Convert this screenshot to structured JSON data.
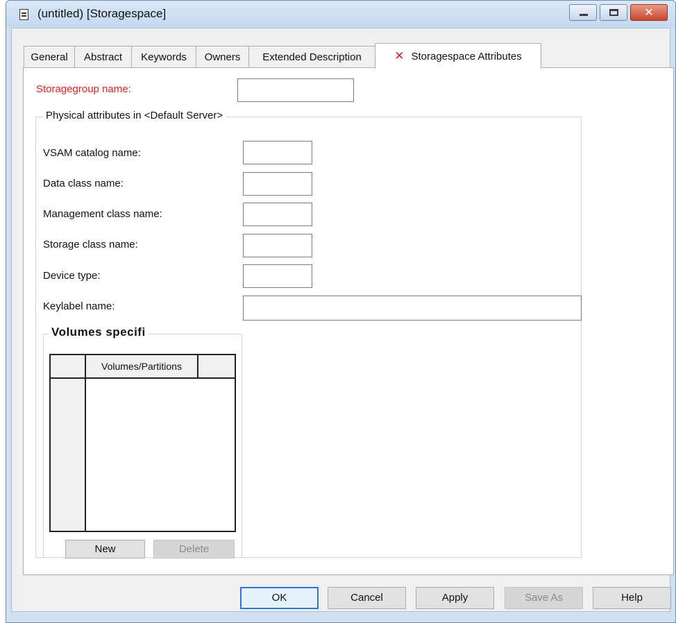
{
  "window": {
    "title": "(untitled) [Storagespace]",
    "icons": {
      "title": "document-icon",
      "minimize": "minimize-icon",
      "maximize": "maximize-icon",
      "close": "close-icon"
    },
    "close_glyph": "✕"
  },
  "tabs": [
    {
      "label": "General"
    },
    {
      "label": "Abstract"
    },
    {
      "label": "Keywords"
    },
    {
      "label": "Owners"
    },
    {
      "label": "Extended Description"
    },
    {
      "label": "Storagespace Attributes",
      "active": true,
      "icon": "red-x-icon",
      "icon_glyph": "✕"
    }
  ],
  "form": {
    "storagegroup_label": "Storagegroup name:",
    "storagegroup_value": "",
    "physical_group_title": "Physical attributes in <Default Server>",
    "fields": [
      {
        "label": "VSAM catalog name:",
        "value": ""
      },
      {
        "label": "Data class name:",
        "value": ""
      },
      {
        "label": "Management class name:",
        "value": ""
      },
      {
        "label": "Storage class name:",
        "value": ""
      },
      {
        "label": "Device type:",
        "value": ""
      },
      {
        "label": "Keylabel name:",
        "value": ""
      }
    ],
    "volumes_group_title": "Volumes specifi",
    "volumes_grid": {
      "columns": [
        "Volumes/Partitions"
      ],
      "rows": []
    },
    "new_label": "New",
    "delete_label": "Delete"
  },
  "buttons": {
    "ok": "OK",
    "cancel": "Cancel",
    "apply": "Apply",
    "save_as": "Save As",
    "help": "Help"
  },
  "colors": {
    "required_label": "#e0201b",
    "close_button": "#c9472d",
    "ok_focus_border": "#2b79d6"
  }
}
